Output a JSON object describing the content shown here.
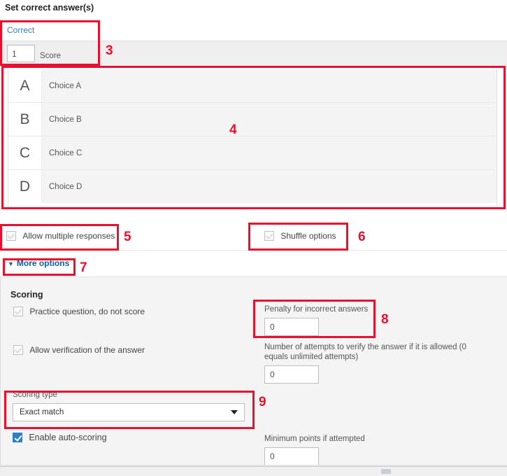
{
  "title": "Set correct answer(s)",
  "answer_tab": {
    "label": "Correct",
    "add_button": "+",
    "score_value": "1",
    "score_label": "Score"
  },
  "choices": [
    {
      "letter": "A",
      "text": "Choice A"
    },
    {
      "letter": "B",
      "text": "Choice B"
    },
    {
      "letter": "C",
      "text": "Choice C"
    },
    {
      "letter": "D",
      "text": "Choice D"
    }
  ],
  "options": {
    "allow_multiple": "Allow multiple responses",
    "allow_multiple_checked": false,
    "shuffle": "Shuffle options",
    "shuffle_checked": false,
    "more_options": "More options",
    "caret": "▼"
  },
  "scoring": {
    "heading": "Scoring",
    "practice_question": "Practice question, do not score",
    "practice_checked": false,
    "allow_verification": "Allow verification of the answer",
    "verification_checked": false,
    "penalty_label": "Penalty for incorrect answers",
    "penalty_value": "0",
    "attempts_label": "Number of attempts to verify the answer if it is allowed (0 equals unlimited attempts)",
    "attempts_value": "0",
    "scoring_type_label": "Scoring type",
    "scoring_type_value": "Exact match",
    "enable_autoscoring": "Enable auto-scoring",
    "autoscoring_checked": true,
    "minimum_points_label": "Minimum points if attempted",
    "minimum_points_value": "0"
  },
  "annotations": {
    "n3": "3",
    "n4": "4",
    "n5": "5",
    "n6": "6",
    "n7": "7",
    "n8": "8",
    "n9": "9"
  },
  "colors": {
    "annotation_red": "#e8112d",
    "link_blue": "#0b5fa5",
    "accent_blue": "#2f7fc4"
  }
}
